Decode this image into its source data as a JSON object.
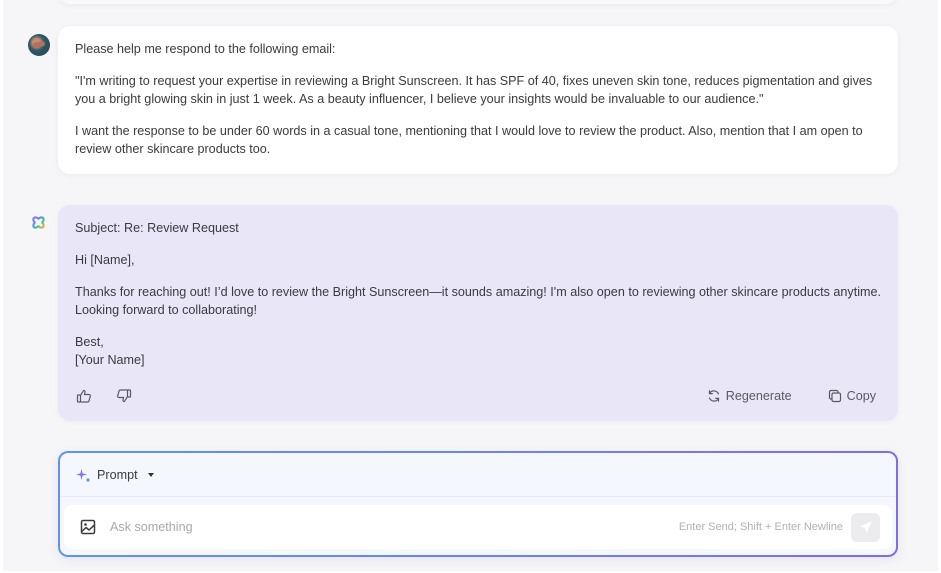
{
  "conversation": {
    "user_message": {
      "avatar_icon": "user-avatar",
      "paragraphs": [
        "Please help me respond to the following email:",
        "\"I'm writing to request your expertise in reviewing a Bright Sunscreen. It has SPF of 40, fixes uneven skin tone, reduces pigmentation and gives you a bright glowing skin in just 1 week. As a beauty influencer, I believe your insights would be invaluable to our audience.\"",
        "I want the response to be under 60 words in a casual tone, mentioning that I would love to review the product. Also, mention that I am open to review other skincare products too."
      ]
    },
    "assistant_message": {
      "avatar_icon": "assistant-logo",
      "subject": "Subject: Re: Review Request",
      "greeting": "Hi [Name],",
      "body": "Thanks for reaching out! I’d love to review the Bright Sunscreen—it sounds amazing! I'm also open to reviewing other skincare products anytime. Looking forward to collaborating!",
      "signoff_line1": "Best,",
      "signoff_line2": "[Your Name]",
      "actions": {
        "thumbs_up_icon": "thumbs-up-icon",
        "thumbs_down_icon": "thumbs-down-icon",
        "regenerate_label": "Regenerate",
        "copy_label": "Copy"
      }
    }
  },
  "composer": {
    "mode_label": "Prompt",
    "input_placeholder": "Ask something",
    "input_value": "",
    "hint": "Enter Send; Shift + Enter Newline",
    "send_icon": "send-icon",
    "image_icon": "image-upload-icon"
  },
  "colors": {
    "assistant_bubble": "#e9e6f7",
    "user_bubble": "#ffffff",
    "border_gradient_start": "#5f95e6",
    "border_gradient_end": "#7d6fe0"
  }
}
